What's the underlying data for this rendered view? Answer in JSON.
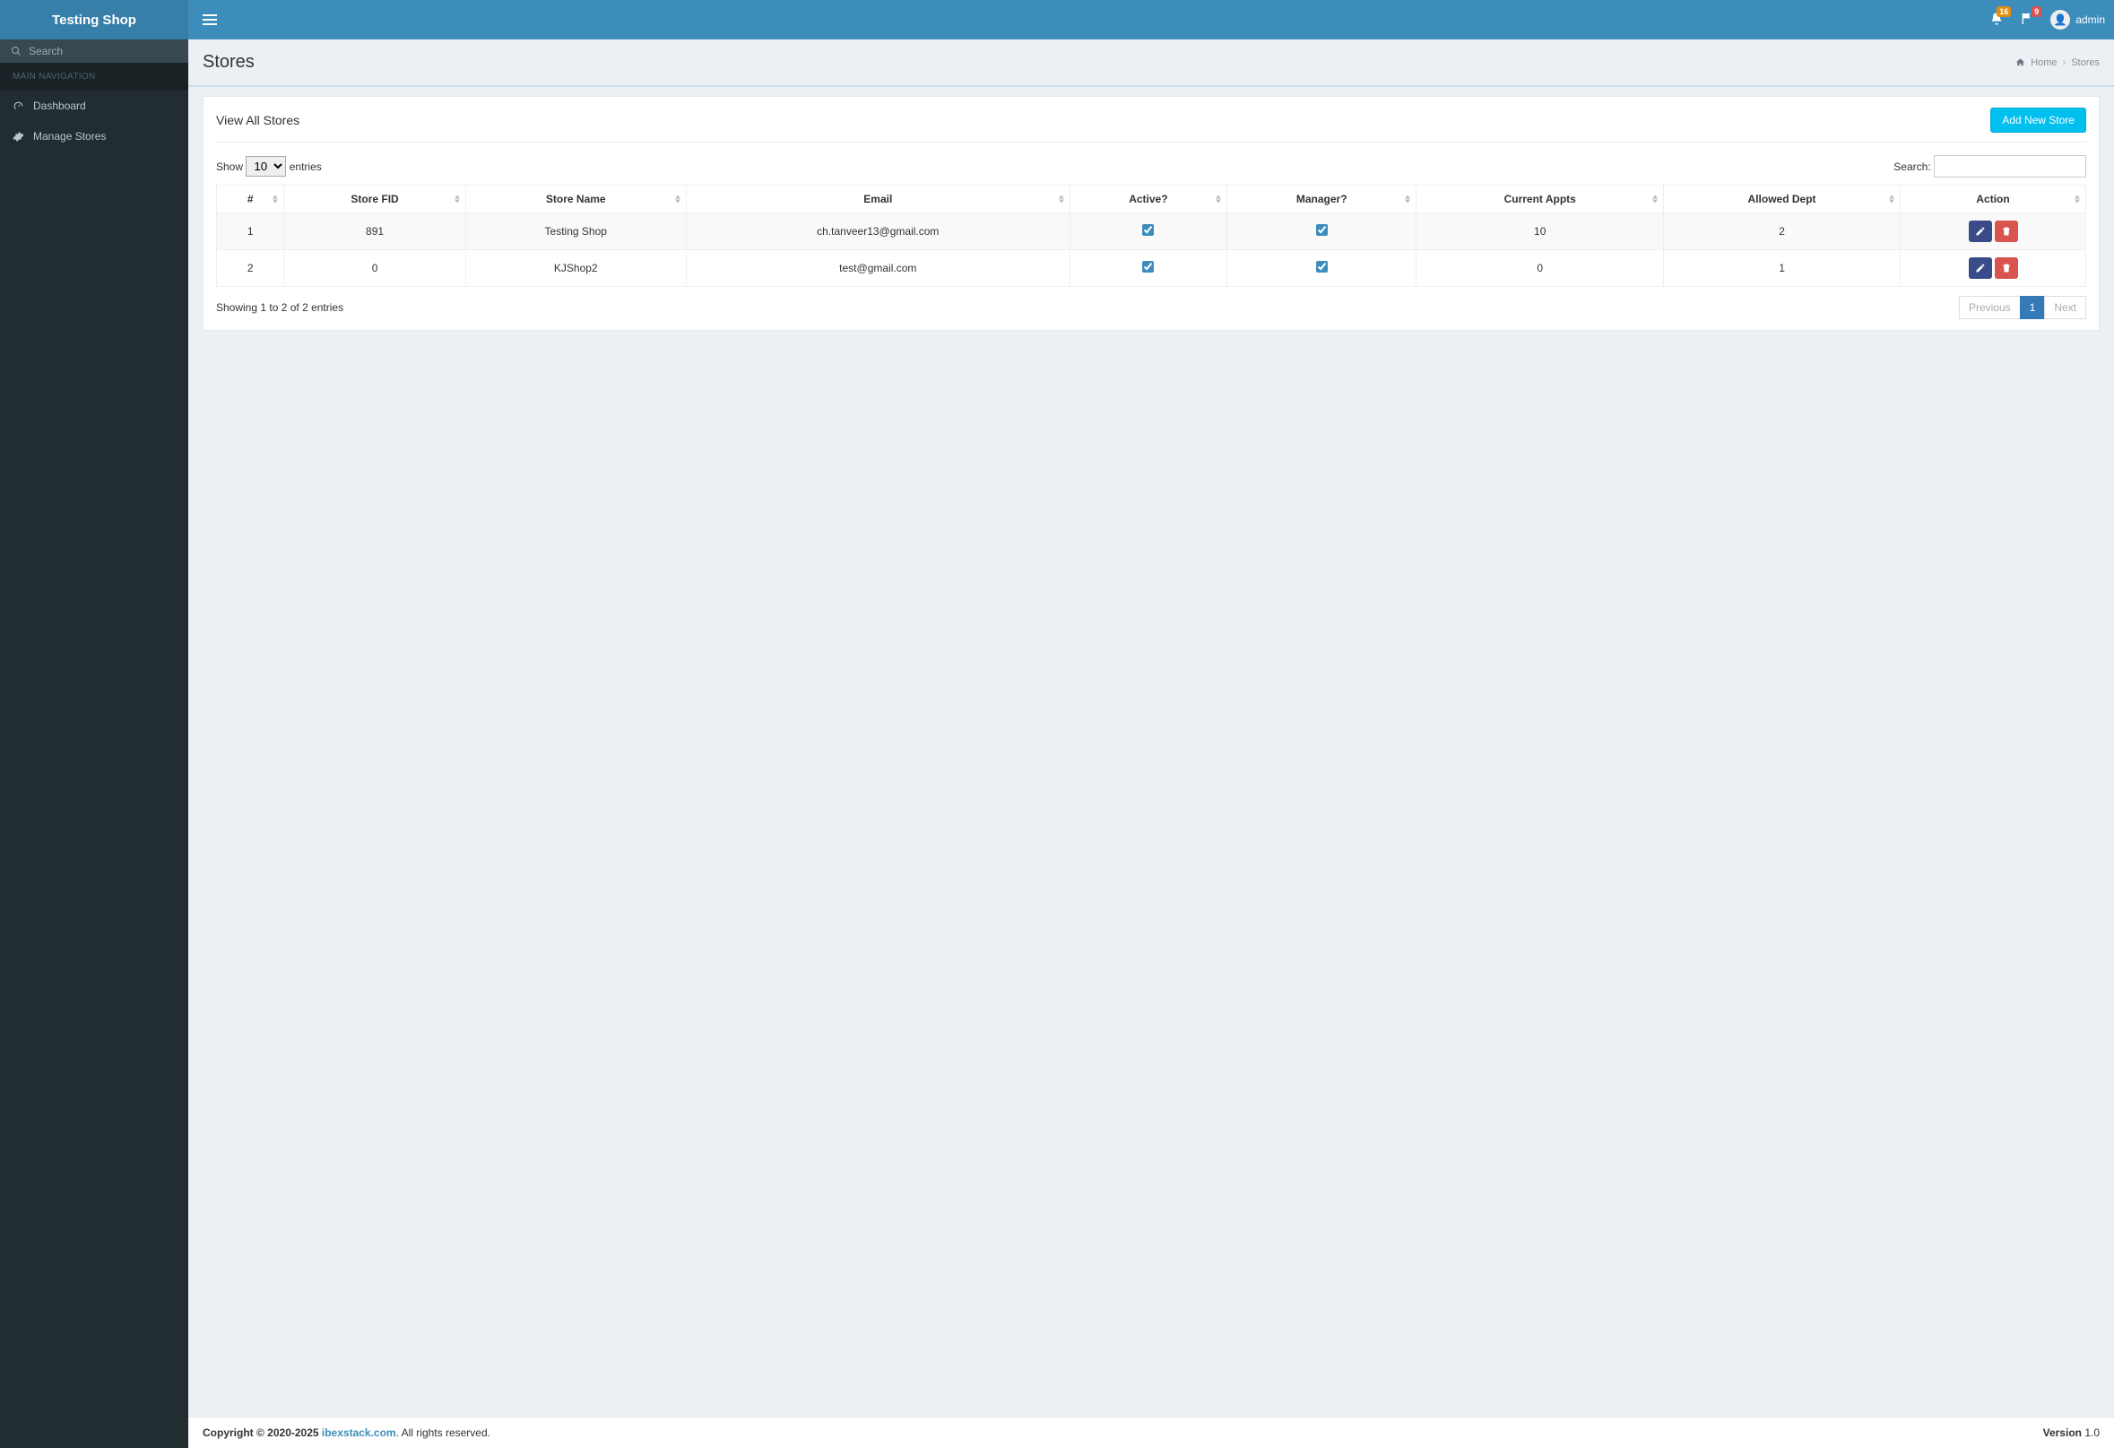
{
  "brand": "Testing Shop",
  "header": {
    "notif_badge": "16",
    "chat_badge": "9",
    "username": "admin"
  },
  "sidebar": {
    "search_label": "Search",
    "section": "MAIN NAVIGATION",
    "items": [
      {
        "label": "Dashboard"
      },
      {
        "label": "Manage Stores"
      }
    ]
  },
  "page": {
    "title": "Stores",
    "breadcrumb_home": "Home",
    "breadcrumb_current": "Stores"
  },
  "panel": {
    "title": "View All Stores",
    "add_btn": "Add New Store"
  },
  "table": {
    "show_prefix": "Show",
    "show_suffix": "entries",
    "show_value": "10",
    "search_label": "Search:",
    "cols": [
      "#",
      "Store FID",
      "Store Name",
      "Email",
      "Active?",
      "Manager?",
      "Current Appts",
      "Allowed Dept",
      "Action"
    ],
    "rows": [
      {
        "n": "1",
        "fid": "891",
        "name": "Testing Shop",
        "email": "ch.tanveer13@gmail.com",
        "active": true,
        "manager": true,
        "appts": "10",
        "dept": "2"
      },
      {
        "n": "2",
        "fid": "0",
        "name": "KJShop2",
        "email": "test@gmail.com",
        "active": true,
        "manager": true,
        "appts": "0",
        "dept": "1"
      }
    ],
    "info": "Showing 1 to 2 of 2 entries",
    "pager_prev": "Previous",
    "pager_page": "1",
    "pager_next": "Next"
  },
  "footer": {
    "copy_prefix": "Copyright © 2020-2025 ",
    "copy_link": "ibexstack.com",
    "copy_suffix": ". All rights reserved.",
    "version_label": "Version ",
    "version_value": "1.0"
  }
}
